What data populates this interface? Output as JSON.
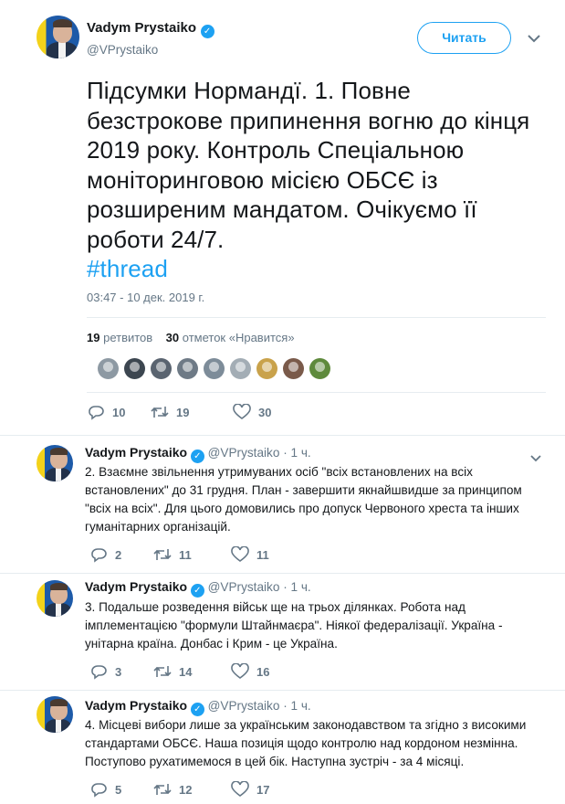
{
  "main": {
    "author_name": "Vadym Prystaiko",
    "author_handle": "@VPrystaiko",
    "follow_label": "Читать",
    "text": "Підсумки Нормандї. 1. Повне безстрокове припинення вогню до кінця 2019 року. Контроль Спеціальною моніторинговою місією ОБСЄ із розширеним мандатом. Очікуємо її роботи 24/7.",
    "hashtag": "#thread",
    "timestamp": "03:47 - 10 дек. 2019 г.",
    "retweets_count": "19",
    "retweets_label": "ретвитов",
    "likes_count": "30",
    "likes_label": "отметок «Нравится»",
    "reply_count": "10",
    "retweet_count": "19",
    "like_count": "30",
    "verified_symbol": "✓"
  },
  "replies": [
    {
      "name": "Vadym Prystaiko",
      "handle": "@VPrystaiko",
      "time": "· 1 ч.",
      "text": "2. Взаємне звільнення утримуваних осіб \"всіх встановлених на всіх встановлених\" до 31 грудня. План - завершити якнайшвидше за принципом \"всіх на всіх\". Для цього домовились про  допуск Червоного хреста та інших гуманітарних організацій.",
      "reply_count": "2",
      "retweet_count": "11",
      "like_count": "11"
    },
    {
      "name": "Vadym Prystaiko",
      "handle": "@VPrystaiko",
      "time": "· 1 ч.",
      "text": "3. Подальше розведення військ ще на трьох ділянках. Робота над імплементацією \"формули Штайнмаєра\". Ніякої федералізації. Україна - унітарна країна. Донбас і Крим - це Україна.",
      "reply_count": "3",
      "retweet_count": "14",
      "like_count": "16"
    },
    {
      "name": "Vadym Prystaiko",
      "handle": "@VPrystaiko",
      "time": "· 1 ч.",
      "text": "4. Місцеві вибори лише за українським законодавством та згідно з високими стандартами ОБСЄ. Наша позиція щодо контролю над кордоном незмінна. Поступово рухатимемося в цей бік. Наступна зустріч - за 4 місяці.",
      "reply_count": "5",
      "retweet_count": "12",
      "like_count": "17"
    }
  ],
  "colors": {
    "accent": "#1da1f2",
    "muted": "#657786",
    "text": "#14171a",
    "divider": "#e6ecf0"
  },
  "icons": [
    "verified-icon",
    "chevron-down-icon",
    "reply-icon",
    "retweet-icon",
    "like-icon"
  ]
}
